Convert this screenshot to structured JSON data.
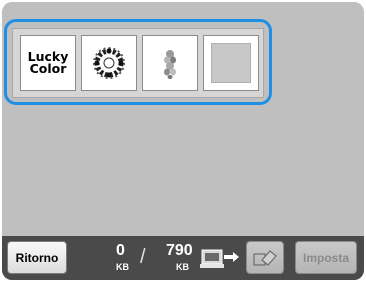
{
  "patterns": [
    {
      "name": "lucky-color",
      "label_line1": "Lucky",
      "label_line2": "Color"
    },
    {
      "name": "wreath-pattern"
    },
    {
      "name": "floral-motif-pattern"
    },
    {
      "name": "empty-pattern"
    }
  ],
  "memory": {
    "used": "0",
    "used_unit": "KB",
    "separator": "/",
    "total": "790",
    "total_unit": "KB"
  },
  "buttons": {
    "back_label": "Ritorno",
    "set_label": "Imposta"
  },
  "colors": {
    "highlight": "#1f8fe6",
    "screen_bg": "#bfbfbf",
    "bar_bg": "#4a4a4a"
  }
}
